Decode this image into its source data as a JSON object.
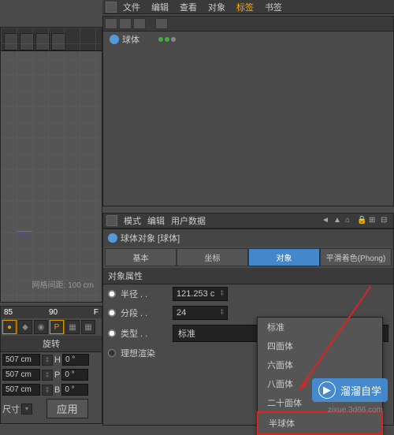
{
  "top_menu": {
    "file": "文件",
    "edit": "编辑",
    "view": "查看",
    "object": "对象",
    "tags": "标签",
    "bookmark": "书签"
  },
  "hierarchy": {
    "item_name": "球体"
  },
  "viewport": {
    "grid_label": "网格间距: 100 cm"
  },
  "timeline": {
    "num1": "85",
    "num2": "90",
    "letter_f": "F",
    "section_rotate": "旋转",
    "row1_a": "507 cm",
    "row1_b": "H",
    "row1_c": "0 °",
    "row2_a": "507 cm",
    "row2_b": "P",
    "row2_c": "0 °",
    "row3_a": "507 cm",
    "row3_b": "B",
    "row3_c": "0 °",
    "size_label": "尺寸",
    "apply": "应用"
  },
  "attr_header": {
    "mode": "模式",
    "edit": "编辑",
    "userdata": "用户数据"
  },
  "attr": {
    "title": "球体对象 [球体]",
    "tabs": {
      "basic": "基本",
      "coord": "坐标",
      "object": "对象",
      "phong": "平滑着色(Phong)"
    },
    "section": "对象属性",
    "rows": {
      "radius_label": "半径 . .",
      "radius_value": "121.253 c",
      "segments_label": "分段 . .",
      "segments_value": "24",
      "type_label": "类型 . .",
      "type_value": "标准",
      "render_label": "理想渲染"
    }
  },
  "dropdown": {
    "opt1": "标准",
    "opt2": "四面体",
    "opt3": "六面体",
    "opt4": "八面体",
    "opt5": "二十面体",
    "opt6": "半球体"
  },
  "watermark": {
    "text": "溜溜自学",
    "sub": "zixue.3d66.com"
  }
}
